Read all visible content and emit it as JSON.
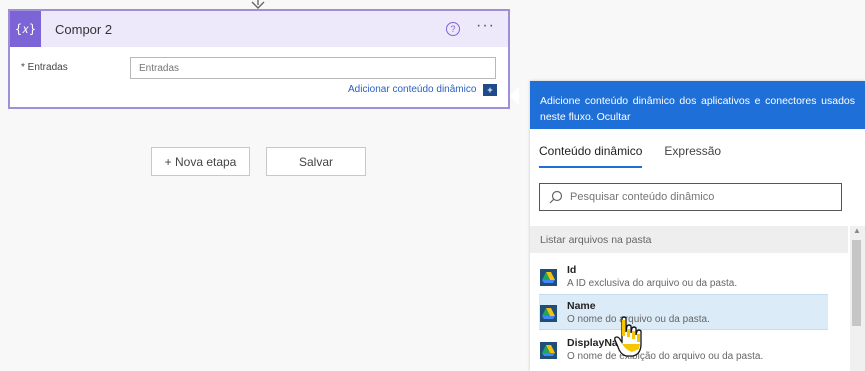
{
  "card": {
    "icon_text": "{𝑥}",
    "title": "Compor 2",
    "field_label": "* Entradas",
    "field_placeholder": "Entradas",
    "dynamic_link": "Adicionar conteúdo dinâmico",
    "dynamic_plus": "+",
    "help_icon": "?",
    "more_icon": "···"
  },
  "buttons": {
    "new_step": "+ Nova etapa",
    "save": "Salvar"
  },
  "panel": {
    "banner": "Adicione conteúdo dinâmico dos aplicativos e conectores usados neste fluxo.",
    "banner_hide": "Ocultar",
    "tabs": [
      "Conteúdo dinâmico",
      "Expressão"
    ],
    "search_placeholder": "Pesquisar conteúdo dinâmico",
    "section": "Listar arquivos na pasta",
    "items": [
      {
        "name": "Id",
        "desc": "A ID exclusiva do arquivo ou da pasta."
      },
      {
        "name": "Name",
        "desc": "O nome do arquivo ou da pasta."
      },
      {
        "name": "DisplayName",
        "desc": "O nome de exibição do arquivo ou da pasta."
      }
    ]
  },
  "colors": {
    "accent": "#7c64d6",
    "banner": "#1f6fd9",
    "link": "#2a5fc4",
    "hover": "#dcebf8"
  },
  "icons": [
    "arrow-down-icon",
    "variable-icon",
    "help-icon",
    "more-icon",
    "dynamic-plus-icon",
    "search-icon",
    "google-drive-icon",
    "hand-cursor-icon"
  ]
}
